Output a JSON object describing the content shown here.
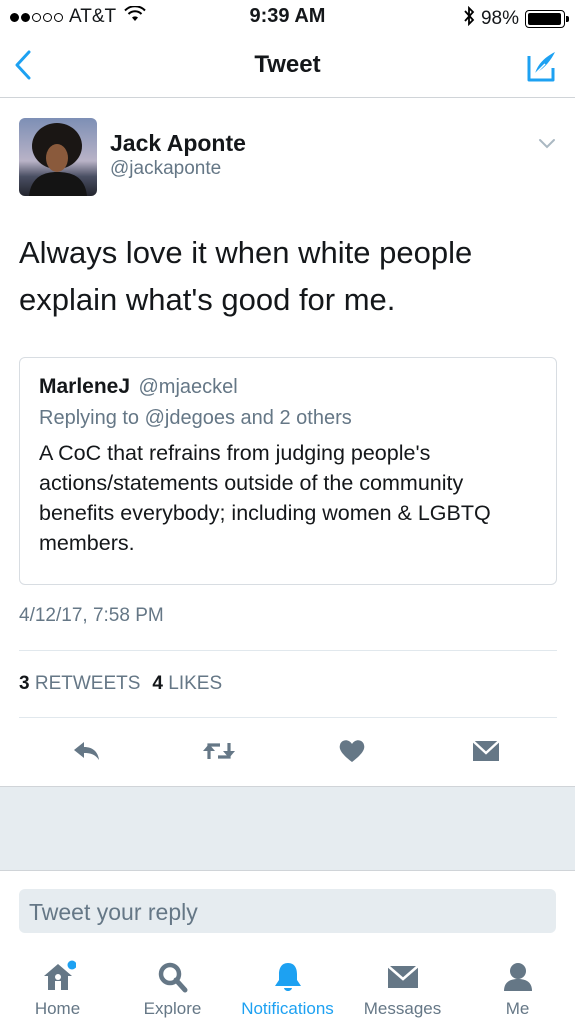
{
  "status_bar": {
    "carrier": "AT&T",
    "time": "9:39 AM",
    "battery": "98%",
    "battery_level": 0.98
  },
  "nav": {
    "title": "Tweet",
    "back_icon": "chevron-left-icon",
    "compose_icon": "compose-icon"
  },
  "tweet": {
    "author_name": "Jack Aponte",
    "author_handle": "@jackaponte",
    "text_line1": "Always love it when white people",
    "text_line2": "explain what's good for me.",
    "timestamp": "4/12/17, 7:58 PM",
    "retweet_count": "3",
    "retweet_label": "RETWEETS",
    "like_count": "4",
    "like_label": "LIKES"
  },
  "quoted": {
    "name": "MarleneJ",
    "handle": "@mjaeckel",
    "reply_context": "Replying to @jdegoes and 2 others",
    "text": "A CoC that refrains from judging people's actions/statements outside of the community benefits everybody; including women & LGBTQ members."
  },
  "reply_box": {
    "placeholder": "Tweet your reply"
  },
  "tabs": [
    {
      "label": "Home",
      "icon": "home-icon"
    },
    {
      "label": "Explore",
      "icon": "search-icon"
    },
    {
      "label": "Notifications",
      "icon": "bell-icon",
      "active": true
    },
    {
      "label": "Messages",
      "icon": "envelope-icon"
    },
    {
      "label": "Me",
      "icon": "person-icon"
    }
  ],
  "colors": {
    "accent": "#1da1f2",
    "secondary_text": "#657786",
    "icon_gray": "#657786"
  }
}
